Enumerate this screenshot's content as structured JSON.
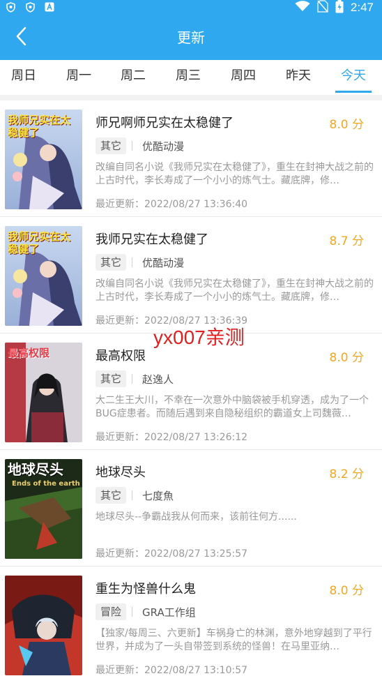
{
  "status_bar": {
    "time": "2:47",
    "left_icons": [
      "shield-icon",
      "shield-icon",
      "a-badge-icon"
    ],
    "right_icons": [
      "wifi-icon",
      "no-sim-icon",
      "battery-charging-icon"
    ]
  },
  "header": {
    "title": "更新",
    "back_icon": "back-arrow-icon",
    "background_color": "#2fa8f0"
  },
  "tabs": [
    {
      "label": "周日",
      "active": false
    },
    {
      "label": "周一",
      "active": false
    },
    {
      "label": "周二",
      "active": false
    },
    {
      "label": "周三",
      "active": false
    },
    {
      "label": "周四",
      "active": false
    },
    {
      "label": "昨天",
      "active": false
    },
    {
      "label": "今天",
      "active": true
    }
  ],
  "items": [
    {
      "title": "师兄啊师兄实在太稳健了",
      "score": "8.0 分",
      "tag": "其它",
      "author": "优酷动漫",
      "description": "改编自同名小说《我师兄实在太稳健了》，重生在封神大战之前的上古时代，李长寿成了一个小小的炼气士。藏底牌，修…",
      "updated": "最近更新：2022/08/27 13:36:40",
      "cover_text": "我师兄实在太稳健了"
    },
    {
      "title": "我师兄实在太稳健了",
      "score": "8.7 分",
      "tag": "其它",
      "author": "优酷动漫",
      "description": "改编自同名小说《我师兄实在太稳健了》，重生在封神大战之前的上古时代，李长寿成了一个小小的炼气士。藏底牌，修…",
      "updated": "最近更新：2022/08/27 13:36:39",
      "cover_text": "我师兄实在太稳健了"
    },
    {
      "title": "最高权限",
      "score": "8.0 分",
      "tag": "其它",
      "author": "赵逸人",
      "description": "大二生王大川，不幸在一次意外中脑袋被手机穿透，成为了一个BUG症患者。而随后遇到来自隐秘组织的霸道女上司魏薇…",
      "updated": "最近更新：2022/08/27 13:26:12",
      "cover_text": "最高权限"
    },
    {
      "title": "地球尽头",
      "score": "8.2 分",
      "tag": "其它",
      "author": "七度魚",
      "description": "地球尽头--争霸战我从何而来，该前往何方......",
      "updated": "最近更新：2022/08/27 13:25:57",
      "cover_text": "地球尽头",
      "cover_subtext": "Ends of the earth"
    },
    {
      "title": "重生为怪兽什么鬼",
      "score": "8.0 分",
      "tag": "冒险",
      "author": "GRA工作组",
      "description": "【独家/每周三、六更新】车祸身亡的林渊，意外地穿越到了平行世界，并成为了一头自带签到系统的怪兽！在马里亚纳…",
      "updated": "最近更新：2022/08/27 13:10:57",
      "cover_text": ""
    }
  ],
  "watermark": "yx007亲测"
}
